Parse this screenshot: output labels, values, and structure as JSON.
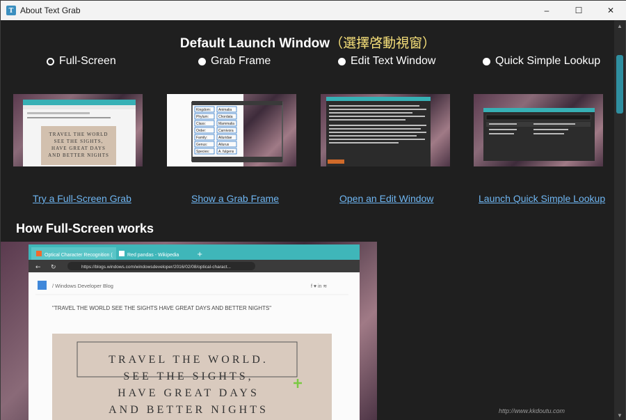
{
  "window": {
    "title": "About Text Grab",
    "minimize": "–",
    "maximize": "☐",
    "close": "✕"
  },
  "launch": {
    "heading": "Default Launch Window",
    "heading_cjk": "（選擇啓動視窗）",
    "options": [
      {
        "label": "Full-Screen",
        "selected": true
      },
      {
        "label": "Grab Frame",
        "selected": false
      },
      {
        "label": "Edit Text Window",
        "selected": false
      },
      {
        "label": "Quick Simple Lookup",
        "selected": false
      }
    ]
  },
  "links": {
    "fullscreen": "Try a Full-Screen Grab",
    "grab_frame": "Show a Grab Frame",
    "edit_window": "Open an Edit Window",
    "quick_lookup": "Launch Quick Simple Lookup"
  },
  "section": {
    "title": "How Full-Screen works"
  },
  "browser": {
    "tab1": "Optical Character Recognition (",
    "tab2": "Red pandas - Wikipedia",
    "address": "https://blogs.windows.com/windowsdeveloper/2016/02/08/optical-charact...",
    "blog_name": "/ Windows Developer Blog",
    "quote": "\"TRAVEL THE WORLD SEE THE SIGHTS HAVE GREAT DAYS AND BETTER NIGHTS\"",
    "poster_lines": [
      "TRAVEL THE WORLD.",
      "SEE THE SIGHTS,",
      "HAVE GREAT DAYS",
      "AND BETTER NIGHTS"
    ]
  },
  "grab_frame_thumb": {
    "rows": [
      [
        "Kingdom:",
        "Animalia"
      ],
      [
        "Phylum:",
        "Chordata"
      ],
      [
        "Class:",
        "Mammalia"
      ],
      [
        "Order:",
        "Carnivora"
      ],
      [
        "Family:",
        "Ailuridae"
      ],
      [
        "Genus:",
        "Ailurus"
      ],
      [
        "Species:",
        "A. fulgens"
      ]
    ]
  },
  "watermark": "http://www.kkdoutu.com"
}
